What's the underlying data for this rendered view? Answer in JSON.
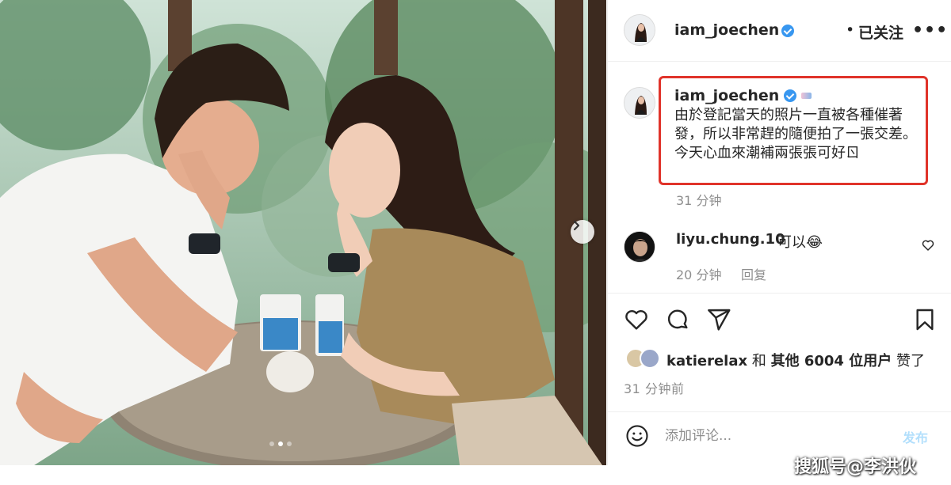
{
  "post": {
    "username": "iam_joechen",
    "bullet": "•",
    "follow_status": "已关注",
    "more_label": "•••"
  },
  "caption": {
    "username": "iam_joechen",
    "text": "由於登記當天的照片一直被各種催著發，所以非常趕的隨便拍了一張交差。\n今天心血來潮補兩張張可好ㄖ",
    "time": "31 分钟"
  },
  "comment": {
    "username": "liyu.chung.10",
    "text": "可以😂",
    "time": "20 分钟",
    "reply_label": "回复"
  },
  "likes": {
    "first_user": "katierelax",
    "joiner": "和",
    "others": "其他 6004 位用户",
    "suffix": "赞了"
  },
  "post_time": "31 分钟前",
  "composer": {
    "placeholder": "添加评论...",
    "post_label": "发布"
  },
  "watermark": "搜狐号@李洪伙",
  "icons": {
    "next": "chevron-right-icon",
    "more": "more-options-icon",
    "like": "heart-icon",
    "comment": "comment-bubble-icon",
    "share": "paper-plane-icon",
    "save": "bookmark-icon",
    "emoji": "smiley-icon"
  },
  "colors": {
    "highlight_box": "#e0332a",
    "verified": "#3897f0",
    "muted_text": "#8e8e8e",
    "post_button": "#b2dffc"
  }
}
